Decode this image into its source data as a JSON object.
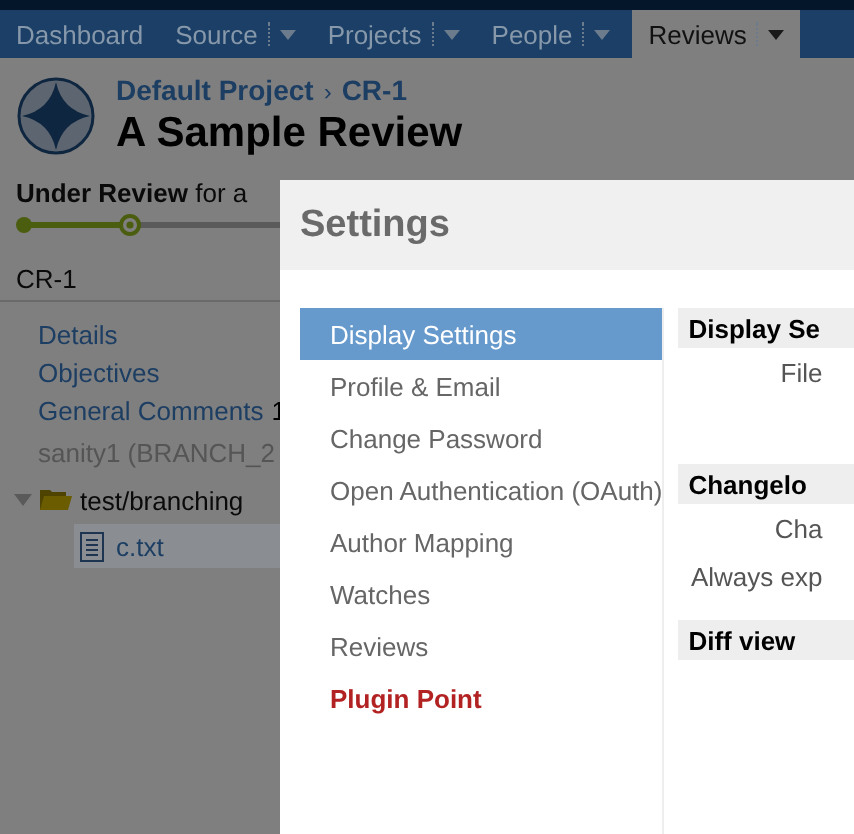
{
  "nav": {
    "tabs": [
      {
        "label": "Dashboard",
        "has_menu": false,
        "selected": false
      },
      {
        "label": "Source",
        "has_menu": true,
        "selected": false
      },
      {
        "label": "Projects",
        "has_menu": true,
        "selected": false
      },
      {
        "label": "People",
        "has_menu": true,
        "selected": false
      },
      {
        "label": "Reviews",
        "has_menu": true,
        "selected": true
      }
    ]
  },
  "header": {
    "project": "Default Project",
    "separator": "›",
    "review_id": "CR-1",
    "title": "A Sample Review"
  },
  "status": {
    "state": "Under Review",
    "text": "for a"
  },
  "sidebar": {
    "title": "CR-1",
    "links": [
      {
        "label": "Details"
      },
      {
        "label": "Objectives"
      },
      {
        "label": "General Comments",
        "count": "1"
      }
    ],
    "changeset": "sanity1 (BRANCH_2",
    "tree": [
      {
        "label": "test/branching",
        "expanded": true,
        "children": [
          {
            "label": "c.txt",
            "selected": true
          }
        ]
      }
    ]
  },
  "modal": {
    "title": "Settings",
    "menu": [
      {
        "label": "Display Settings",
        "selected": true,
        "kind": "normal"
      },
      {
        "label": "Profile & Email",
        "selected": false,
        "kind": "normal"
      },
      {
        "label": "Change Password",
        "selected": false,
        "kind": "normal"
      },
      {
        "label": "Open Authentication (OAuth)",
        "selected": false,
        "kind": "normal"
      },
      {
        "label": "Author Mapping",
        "selected": false,
        "kind": "normal"
      },
      {
        "label": "Watches",
        "selected": false,
        "kind": "normal"
      },
      {
        "label": "Reviews",
        "selected": false,
        "kind": "normal"
      },
      {
        "label": "Plugin Point",
        "selected": false,
        "kind": "plugin"
      }
    ],
    "sections": [
      {
        "title": "Display Se",
        "rows": [
          "File"
        ]
      },
      {
        "title": "Changelo",
        "rows": [
          "Cha",
          "Always exp"
        ]
      },
      {
        "title": "Diff view"
      }
    ]
  }
}
